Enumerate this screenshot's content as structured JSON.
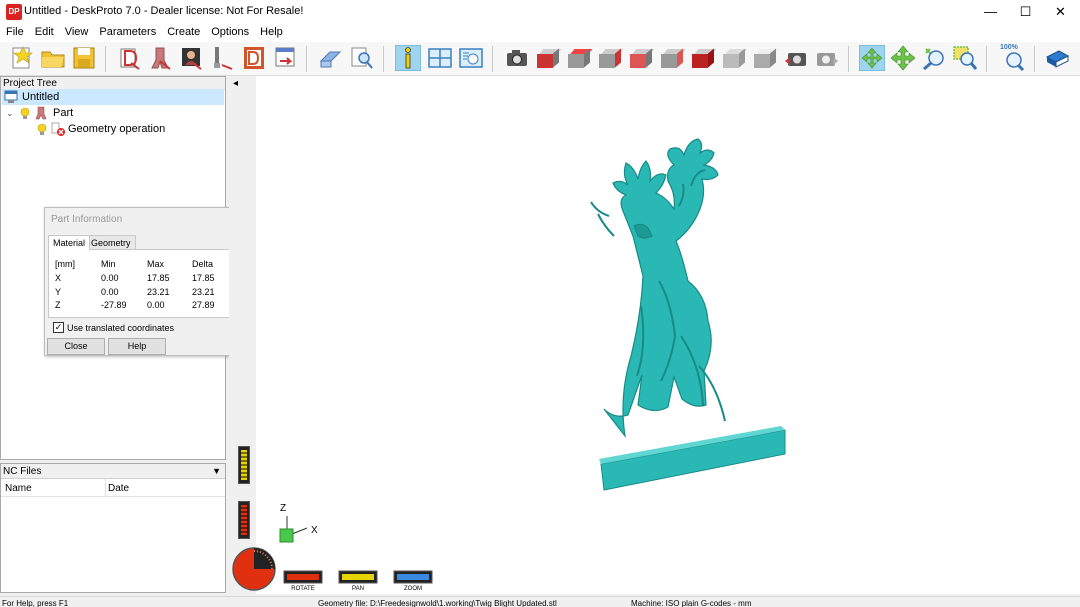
{
  "window": {
    "title": "Untitled - DeskProto 7.0 - Dealer license: Not For Resale!",
    "app_icon_text": "DP",
    "minimize_glyph": "—",
    "maximize_glyph": "☐",
    "close_glyph": "✕"
  },
  "menu": [
    "File",
    "Edit",
    "View",
    "Parameters",
    "Create",
    "Options",
    "Help"
  ],
  "toolbar": {
    "zoom_level": "100%",
    "accent_color": "#d4542a",
    "view_active_color": "#9ed4ee"
  },
  "project_tree": {
    "header": "Project Tree",
    "items": [
      {
        "label": "Untitled"
      },
      {
        "label": "Part"
      },
      {
        "label": "Geometry operation"
      }
    ]
  },
  "part_info": {
    "title": "Part Information",
    "tabs": [
      "Material",
      "Geometry"
    ],
    "columns": [
      "[mm]",
      "Min",
      "Max",
      "Delta"
    ],
    "rows": [
      [
        "X",
        "0.00",
        "17.85",
        "17.85"
      ],
      [
        "Y",
        "0.00",
        "23.21",
        "23.21"
      ],
      [
        "Z",
        "-27.89",
        "0.00",
        "27.89"
      ]
    ],
    "checkbox_label": "Use translated coordinates",
    "checkbox_checked": true,
    "close_label": "Close",
    "help_label": "Help",
    "more_glyph": "▼"
  },
  "nc_files": {
    "header": "NC Files",
    "dropdown_glyph": "▼",
    "columns": [
      "Name",
      "Date"
    ]
  },
  "viewport": {
    "collapse_glyph": "◂",
    "axis_z": "Z",
    "axis_x": "X",
    "model_color": "#2ab8b4",
    "controls": {
      "rotate": "ROTATE",
      "pan": "PAN",
      "zoom": "ZOOM"
    }
  },
  "status": {
    "help": "For Help, press F1",
    "geometry": "Geometry file: D:\\Freedesignwold\\1.working\\Twig Blight Updated.stl",
    "machine": "Machine: ISO plain G-codes - mm"
  }
}
